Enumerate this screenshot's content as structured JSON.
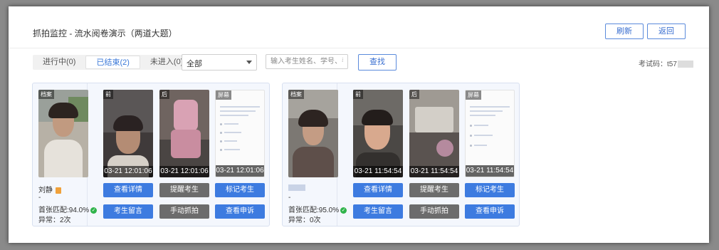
{
  "header": {
    "title": "抓拍监控 - 流水阅卷演示（两道大题）",
    "refresh_label": "刷新",
    "back_label": "返回"
  },
  "filters": {
    "tabs": [
      {
        "label": "进行中(0)",
        "active": false
      },
      {
        "label": "已结束(2)",
        "active": true
      },
      {
        "label": "未进入(0)",
        "active": false
      }
    ],
    "select_value": "全部",
    "search_placeholder": "输入考生姓名、学号、手机号",
    "search_button": "查找",
    "exam_code_label": "考试码：t57"
  },
  "colors": {
    "accent": "#3d7be0",
    "gray_button": "#6c6c6c",
    "ok": "#2fb34a"
  },
  "students": [
    {
      "name": "刘静",
      "dash": "-",
      "match": "首张匹配:94.0%",
      "abnormal": "异常：2次",
      "profile_tag": "档案",
      "photos": [
        {
          "tag": "前",
          "time": "03-21 12:01:06"
        },
        {
          "tag": "后",
          "time": "03-21 12:01:06"
        },
        {
          "tag": "屏幕",
          "time": "03-21 12:01:06"
        }
      ],
      "actions": [
        "查看详情",
        "提醒考生",
        "标记考生",
        "考生留言",
        "手动抓拍",
        "查看申诉"
      ]
    },
    {
      "name": "",
      "dash": "-",
      "match": "首张匹配:95.0%",
      "abnormal": "异常：0次",
      "profile_tag": "档案",
      "photos": [
        {
          "tag": "前",
          "time": "03-21 11:54:54"
        },
        {
          "tag": "后",
          "time": "03-21 11:54:54"
        },
        {
          "tag": "屏幕",
          "time": "03-21 11:54:54"
        }
      ],
      "actions": [
        "查看详情",
        "提醒考生",
        "标记考生",
        "考生留言",
        "手动抓拍",
        "查看申诉"
      ]
    }
  ]
}
